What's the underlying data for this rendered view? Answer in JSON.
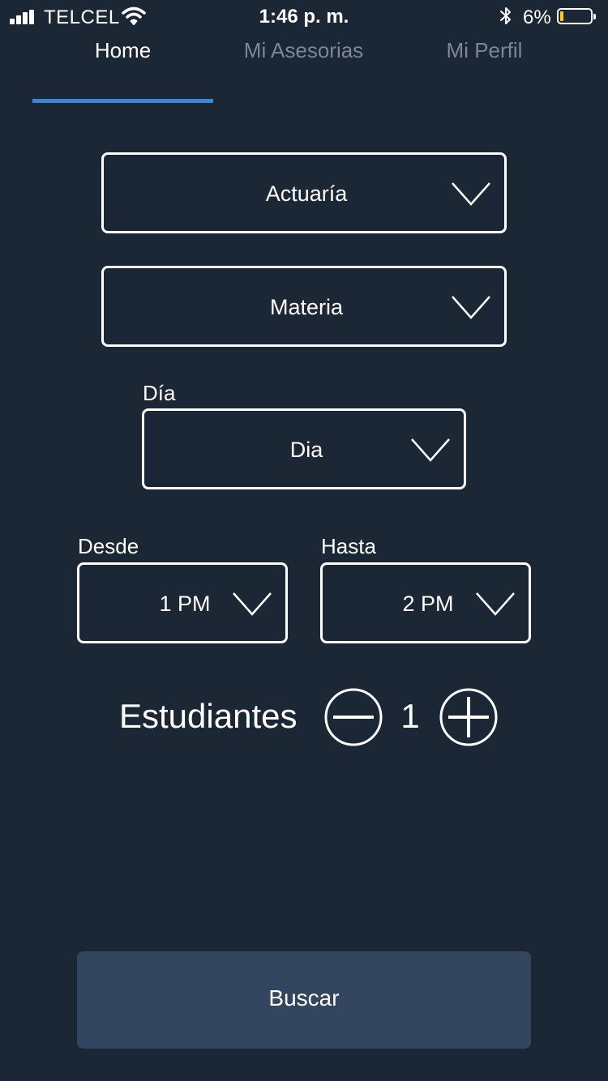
{
  "status_bar": {
    "carrier": "TELCEL",
    "time": "1:46 p. m.",
    "battery_percent": "6%",
    "battery_level": 0.06,
    "battery_color": "#ffcc00"
  },
  "tabs": [
    {
      "label": "Home",
      "active": true
    },
    {
      "label": "Mi Asesorias",
      "active": false
    },
    {
      "label": "Mi Perfil",
      "active": false
    }
  ],
  "form": {
    "career_value": "Actuaría",
    "subject_value": "Materia",
    "day_label": "Día",
    "day_value": "Dia",
    "from_label": "Desde",
    "from_value": "1 PM",
    "to_label": "Hasta",
    "to_value": "2 PM",
    "students_label": "Estudiantes",
    "students_count": "1"
  },
  "search_button_label": "Buscar",
  "colors": {
    "background": "#1c2736",
    "accent": "#3b87d9",
    "button": "#33465f",
    "inactive_tab": "#7c8694"
  }
}
